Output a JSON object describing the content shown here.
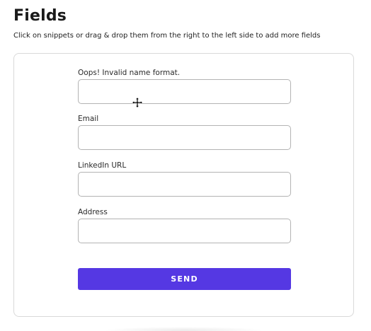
{
  "header": {
    "title": "Fields",
    "subtitle": "Click on snippets or drag & drop them from the right to the left side to add more fields"
  },
  "form": {
    "fields": [
      {
        "label": "Oops! Invalid name format.",
        "value": ""
      },
      {
        "label": "Email",
        "value": ""
      },
      {
        "label": "LinkedIn URL",
        "value": ""
      },
      {
        "label": "Address",
        "value": ""
      }
    ],
    "submit_label": "SEND"
  },
  "colors": {
    "accent": "#5538e3",
    "border": "#b3b3b3"
  },
  "icons": {
    "cursor": "move-cursor-icon"
  }
}
